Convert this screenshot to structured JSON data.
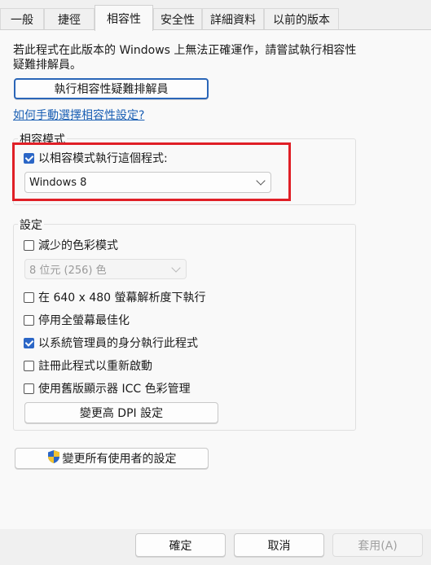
{
  "tabs": [
    {
      "label": "一般"
    },
    {
      "label": "捷徑"
    },
    {
      "label": "相容性"
    },
    {
      "label": "安全性"
    },
    {
      "label": "詳細資料"
    },
    {
      "label": "以前的版本"
    }
  ],
  "active_tab": "相容性",
  "description": "若此程式在此版本的 Windows 上無法正確運作，請嘗試執行相容性疑難排解員。",
  "troubleshooter_button": "執行相容性疑難排解員",
  "manual_link": "如何手動選擇相容性設定?",
  "compat_mode": {
    "legend": "相容模式",
    "checkbox_label": "以相容模式執行這個程式:",
    "checked": true,
    "selected_os": "Windows 8",
    "highlight_color": "#e01f26"
  },
  "settings": {
    "legend": "設定",
    "reduced_color": {
      "label": "減少的色彩模式",
      "checked": false
    },
    "color_select": "8 位元 (256) 色",
    "run_640": {
      "label": "在 640 x 480 螢幕解析度下執行",
      "checked": false
    },
    "disable_fullscreen": {
      "label": "停用全螢幕最佳化",
      "checked": false
    },
    "run_admin": {
      "label": "以系統管理員的身分執行此程式",
      "checked": true
    },
    "register_restart": {
      "label": "註冊此程式以重新啟動",
      "checked": false
    },
    "legacy_icc": {
      "label": "使用舊版顯示器 ICC 色彩管理",
      "checked": false
    },
    "dpi_button": "變更高 DPI 設定"
  },
  "all_users_button": "變更所有使用者的設定",
  "footer": {
    "ok": "確定",
    "cancel": "取消",
    "apply": "套用(A)"
  },
  "colors": {
    "accent": "#2b66c6",
    "link": "#1a5fb4"
  }
}
